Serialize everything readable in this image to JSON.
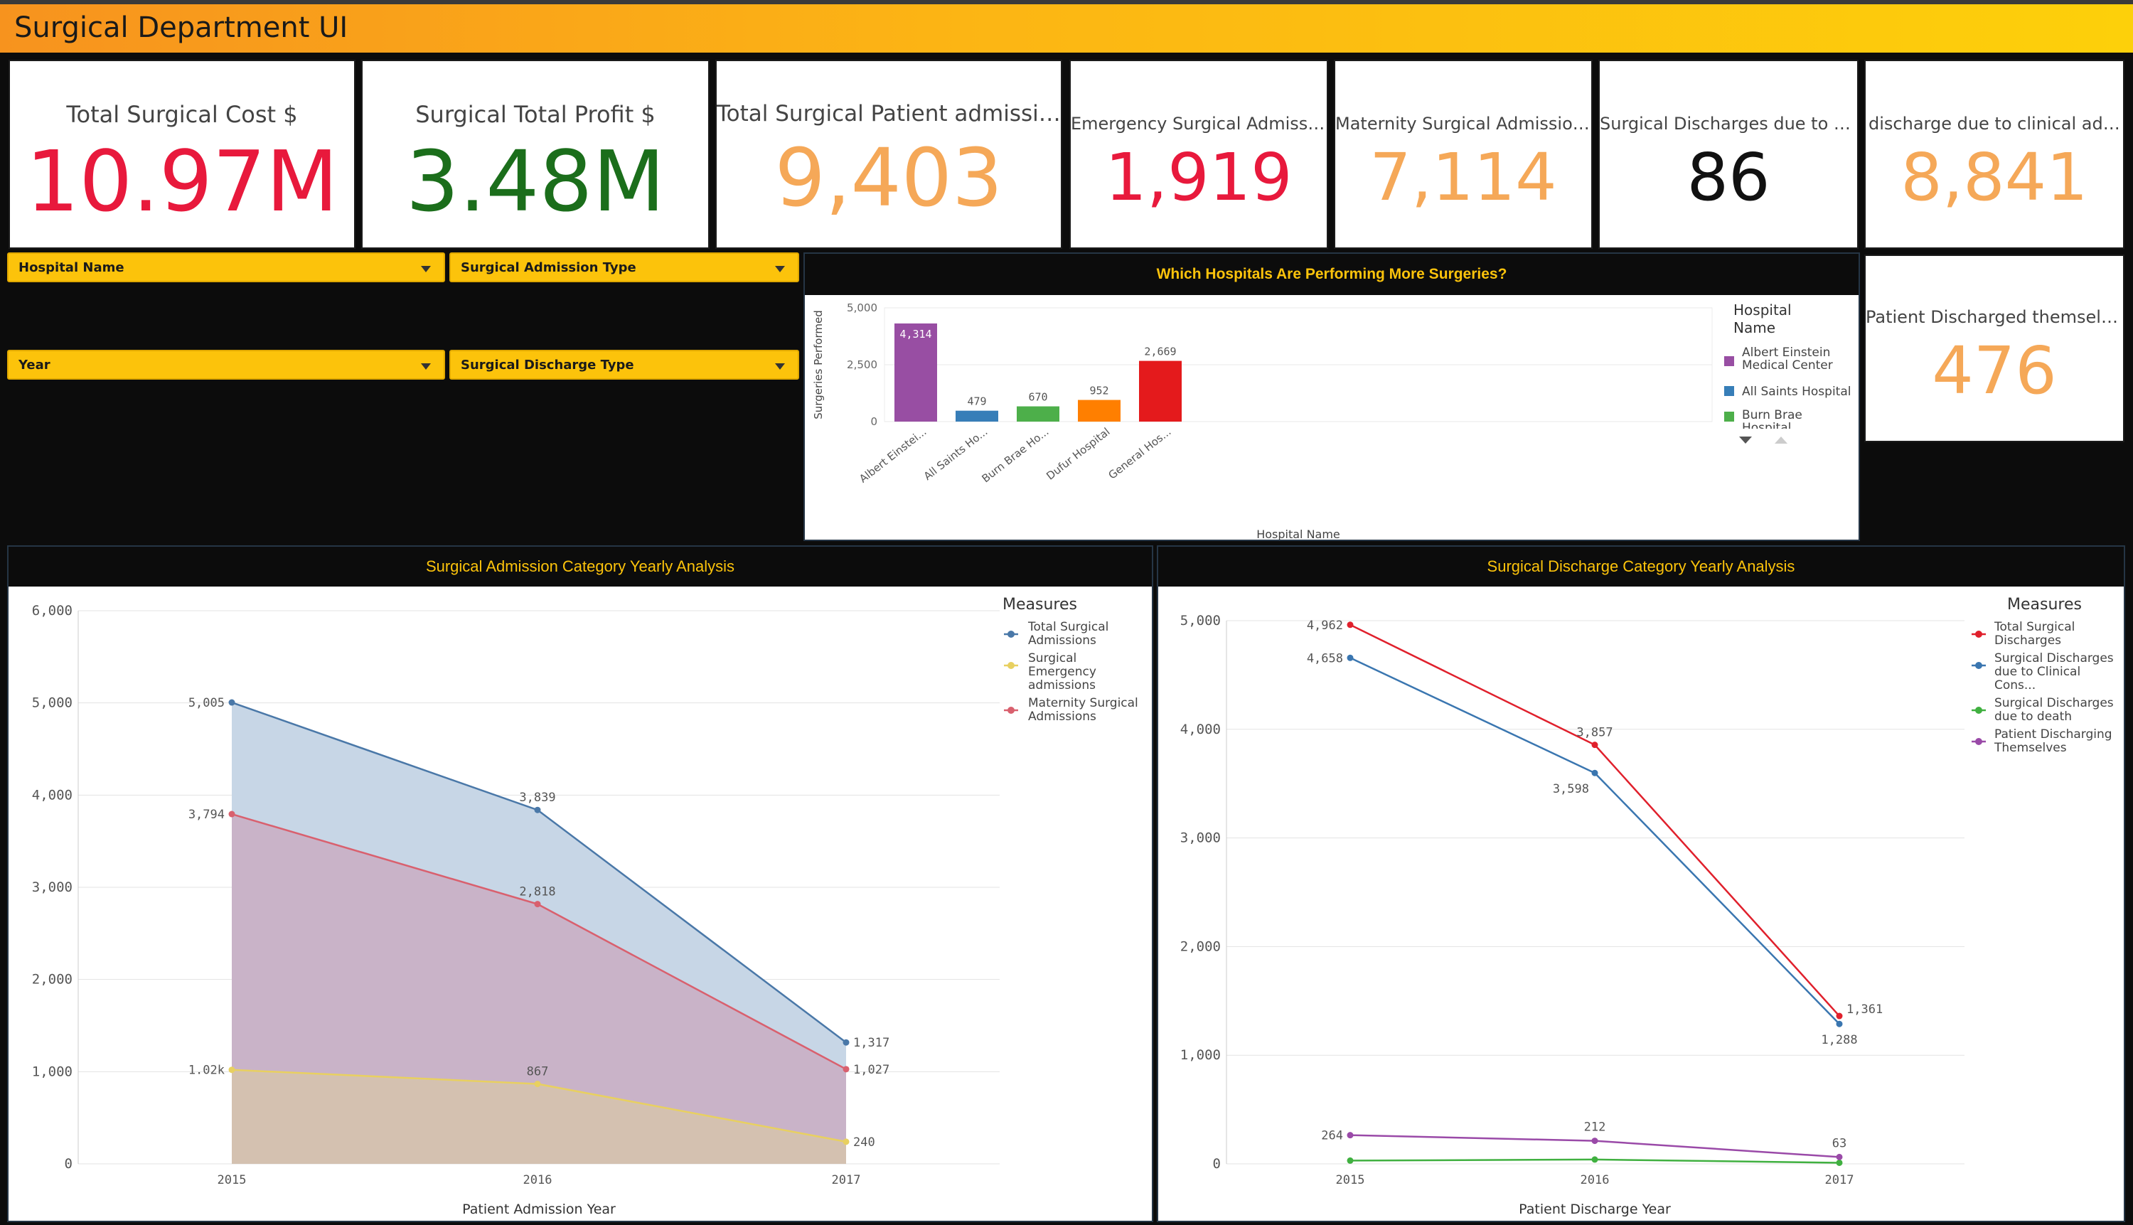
{
  "app_title": "Surgical Department UI",
  "kpis": [
    {
      "label": "Total Surgical Cost $",
      "value": "10.97M",
      "color": "#e8193c"
    },
    {
      "label": "Surgical Total Profit $",
      "value": "3.48M",
      "color": "#1b6e1b"
    },
    {
      "label": "Total Surgical Patient admissions",
      "value": "9,403",
      "color": "#f5a858"
    },
    {
      "label": "Emergency Surgical Admissions",
      "value": "1,919",
      "color": "#e8193c"
    },
    {
      "label": "Maternity Surgical Admissions",
      "value": "7,114",
      "color": "#f5a858"
    },
    {
      "label": "Surgical Discharges due to Death",
      "value": "86",
      "color": "#111111"
    },
    {
      "label": "discharge due to clinical advise...",
      "value": "8,841",
      "color": "#f5a858"
    },
    {
      "label": "Patient Discharged themselves",
      "value": "476",
      "color": "#f5a858"
    }
  ],
  "filters": {
    "hospital_name": "Hospital Name",
    "admission_type": "Surgical Admission Type",
    "year": "Year",
    "discharge_type": "Surgical Discharge Type"
  },
  "hospital_chart": {
    "title": "Which Hospitals Are Performing More Surgeries?",
    "legend_title_1": "Hospital",
    "legend_title_2": "Name",
    "legend": [
      {
        "line1": "Albert Einstein",
        "line2": "Medical Center",
        "color": "#984ea3"
      },
      {
        "line1": "All Saints Hospital",
        "line2": "",
        "color": "#377eb8"
      },
      {
        "line1": "Burn Brae",
        "line2": "Hospital",
        "color": "#4daf4a"
      }
    ]
  },
  "admission_chart": {
    "title": "Surgical Admission Category Yearly Analysis",
    "legend_title": "Measures",
    "legend": [
      {
        "lines": [
          "Total Surgical",
          "Admissions"
        ],
        "color": "#4a78a8"
      },
      {
        "lines": [
          "Surgical",
          "Emergency",
          "admissions"
        ],
        "color": "#e8d060"
      },
      {
        "lines": [
          "Maternity Surgical",
          "Admissions"
        ],
        "color": "#d9606e"
      }
    ]
  },
  "discharge_chart": {
    "title": "Surgical Discharge Category Yearly Analysis",
    "legend_title": "Measures",
    "legend": [
      {
        "lines": [
          "Total Surgical",
          "Discharges"
        ],
        "color": "#e0202c"
      },
      {
        "lines": [
          "Surgical Discharges",
          "due to Clinical",
          "Cons..."
        ],
        "color": "#3a76b0"
      },
      {
        "lines": [
          "Surgical Discharges",
          "due to death"
        ],
        "color": "#40b040"
      },
      {
        "lines": [
          "Patient Discharging",
          "Themselves"
        ],
        "color": "#9a4aa8"
      }
    ]
  },
  "chart_data": [
    {
      "type": "bar",
      "title": "Which Hospitals Are Performing More Surgeries?",
      "xlabel": "Hospital Name",
      "ylabel": "Surgeries Performed",
      "categories": [
        "Albert Einstei...",
        "All Saints Ho...",
        "Burn Brae Ho...",
        "Dufur Hospital",
        "General Hos..."
      ],
      "values": [
        4314,
        479,
        670,
        952,
        2669
      ],
      "value_labels": [
        "4,314",
        "479",
        "670",
        "952",
        "2,669"
      ],
      "colors": [
        "#984ea3",
        "#377eb8",
        "#4daf4a",
        "#ff7f00",
        "#e41a1c"
      ],
      "ylim": [
        0,
        5000
      ],
      "yticks": [
        0,
        2500,
        5000
      ],
      "ytick_labels": [
        "0",
        "2,500",
        "5,000"
      ]
    },
    {
      "type": "area",
      "title": "Surgical Admission Category Yearly Analysis",
      "xlabel": "Patient Admission Year",
      "ylabel": "",
      "x": [
        "2015",
        "2016",
        "2017"
      ],
      "ylim": [
        0,
        6000
      ],
      "yticks": [
        0,
        1000,
        2000,
        3000,
        4000,
        5000,
        6000
      ],
      "ytick_labels": [
        "0",
        "1,000",
        "2,000",
        "3,000",
        "4,000",
        "5,000",
        "6,000"
      ],
      "series": [
        {
          "name": "Total Surgical Admissions",
          "values": [
            5005,
            3839,
            1317
          ],
          "labels": [
            "5,005",
            "3,839",
            "1,317"
          ],
          "color": "#4a78a8",
          "fill": "#c7d6e6"
        },
        {
          "name": "Maternity Surgical Admissions",
          "values": [
            3794,
            2818,
            1027
          ],
          "labels": [
            "3,794",
            "2,818",
            "1,027"
          ],
          "color": "#d9606e",
          "fill": "#c9b3c8"
        },
        {
          "name": "Surgical Emergency admissions",
          "values": [
            1020,
            867,
            240
          ],
          "labels": [
            "1.02k",
            "867",
            "240"
          ],
          "color": "#e8d060",
          "fill": "#d4c1b0"
        }
      ]
    },
    {
      "type": "line",
      "title": "Surgical Discharge Category Yearly Analysis",
      "xlabel": "Patient Discharge Year",
      "ylabel": "",
      "x": [
        "2015",
        "2016",
        "2017"
      ],
      "ylim": [
        0,
        5000
      ],
      "yticks": [
        0,
        1000,
        2000,
        3000,
        4000,
        5000
      ],
      "ytick_labels": [
        "0",
        "1,000",
        "2,000",
        "3,000",
        "4,000",
        "5,000"
      ],
      "series": [
        {
          "name": "Total Surgical Discharges",
          "values": [
            4962,
            3857,
            1361
          ],
          "labels": [
            "4,962",
            "3,857",
            "1,361"
          ],
          "color": "#e0202c"
        },
        {
          "name": "Surgical Discharges due to Clinical Cons...",
          "values": [
            4658,
            3598,
            1288
          ],
          "labels": [
            "4,658",
            "3,598",
            "1,288"
          ],
          "color": "#3a76b0"
        },
        {
          "name": "Surgical Discharges due to death",
          "values": [
            30,
            40,
            10
          ],
          "labels": [
            "",
            "",
            ""
          ],
          "color": "#40b040"
        },
        {
          "name": "Patient Discharging Themselves",
          "values": [
            264,
            212,
            63
          ],
          "labels": [
            "264",
            "212",
            "63"
          ],
          "color": "#9a4aa8"
        }
      ]
    }
  ]
}
